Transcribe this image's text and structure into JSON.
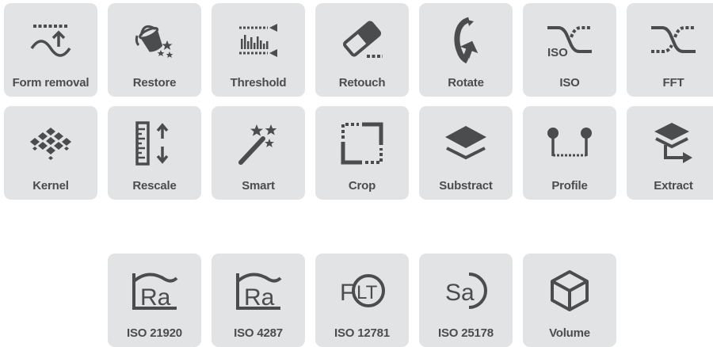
{
  "colors": {
    "tile_bg": "#e2e3e4",
    "icon": "#4a4c4e",
    "label": "#4a4c4e",
    "page_bg": "#ffffff"
  },
  "tiles": [
    {
      "id": "form-removal",
      "label": "Form removal",
      "icon": "form-removal-icon"
    },
    {
      "id": "restore",
      "label": "Restore",
      "icon": "paint-bucket-icon"
    },
    {
      "id": "threshold",
      "label": "Threshold",
      "icon": "threshold-icon"
    },
    {
      "id": "retouch",
      "label": "Retouch",
      "icon": "eraser-icon"
    },
    {
      "id": "rotate",
      "label": "Rotate",
      "icon": "rotate-icon"
    },
    {
      "id": "iso",
      "label": "ISO",
      "icon": "iso-filter-icon"
    },
    {
      "id": "fft",
      "label": "FFT",
      "icon": "fft-filter-icon"
    },
    {
      "id": "kernel",
      "label": "Kernel",
      "icon": "kernel-icon"
    },
    {
      "id": "rescale",
      "label": "Rescale",
      "icon": "ruler-icon"
    },
    {
      "id": "smart",
      "label": "Smart",
      "icon": "magic-wand-icon"
    },
    {
      "id": "crop",
      "label": "Crop",
      "icon": "crop-icon"
    },
    {
      "id": "substract",
      "label": "Substract",
      "icon": "layers-icon"
    },
    {
      "id": "profile",
      "label": "Profile",
      "icon": "profile-icon"
    },
    {
      "id": "extract",
      "label": "Extract",
      "icon": "extract-layers-icon"
    },
    {
      "id": "iso-21920",
      "label": "ISO 21920",
      "icon": "ra-profile-icon",
      "glyph": "Ra"
    },
    {
      "id": "iso-4287",
      "label": "ISO 4287",
      "icon": "ra-profile-icon",
      "glyph": "Ra"
    },
    {
      "id": "iso-12781",
      "label": "ISO 12781",
      "icon": "flt-icon",
      "glyph": "LT",
      "glyph_prefix": "F"
    },
    {
      "id": "iso-25178",
      "label": "ISO 25178",
      "icon": "sa-icon",
      "glyph": "Sa"
    },
    {
      "id": "volume",
      "label": "Volume",
      "icon": "cube-icon"
    }
  ]
}
